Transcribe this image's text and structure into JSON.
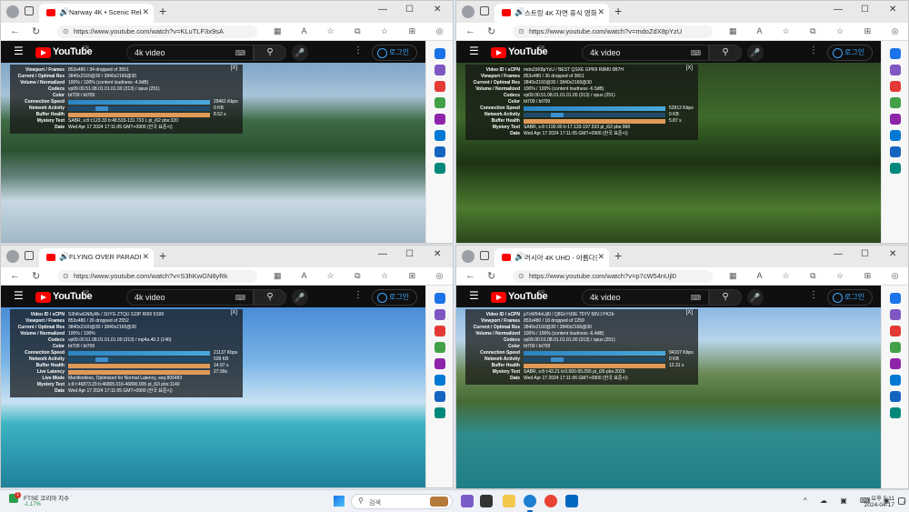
{
  "windows": [
    {
      "tab_title": "Narway 4K • Scenic Relaxat",
      "url": "https://www.youtube.com/watch?v=KLuTLF3x9sA",
      "stats": [
        {
          "label": "Viewport / Frames",
          "value": "853x480 / 34 dropped of 3551"
        },
        {
          "label": "Current / Optimal Res",
          "value": "3840x2160@30 / 3840x2160@30"
        },
        {
          "label": "Volume / Normalized",
          "value": "100% / 100% (content loudness -4.9dB)"
        },
        {
          "label": "Codecs",
          "value": "vp09.00.51.08.01.01.01.00 (313) / opus (251)"
        },
        {
          "label": "Color",
          "value": "bt709 / bt709"
        },
        {
          "label": "Connection Speed",
          "bar": "speed",
          "value": "29461 Kbps"
        },
        {
          "label": "Network Activity",
          "bar": "net",
          "value": "0 KB"
        },
        {
          "label": "Buffer Health",
          "bar": "buf",
          "value": "8.52 s"
        },
        {
          "label": "Mystery Text",
          "value": "SABR, s:8 t:123.33 b:48.533-131.733 L pl_i62 pbs:320"
        },
        {
          "label": "Date",
          "value": "Wed Apr 17 2024 17:11:05 GMT+0900 (한국 표준시)"
        }
      ]
    },
    {
      "tab_title": "스트링 4K 자연 휴식 영화드",
      "url": "https://www.youtube.com/watch?v=mdoZdX8pYzU",
      "stats": [
        {
          "label": "Video ID / sCPN",
          "value": "mdoZdX8pYzU / BEST QSXE GPR9 R8M0 0B7H"
        },
        {
          "label": "Viewport / Frames",
          "value": "853x480 / 36 dropped of 3651"
        },
        {
          "label": "Current / Optimal Res",
          "value": "3840x2160@30 / 3840x2160@30"
        },
        {
          "label": "Volume / Normalized",
          "value": "100% / 100% (content loudness -6.5dB)"
        },
        {
          "label": "Codecs",
          "value": "vp09.00.51.08.01.01.01.00 (313) / opus (251)"
        },
        {
          "label": "Color",
          "value": "bt709 / bt709"
        },
        {
          "label": "Connection Speed",
          "bar": "speed",
          "value": "53912 Kbps"
        },
        {
          "label": "Network Activity",
          "bar": "net",
          "value": "0 KB"
        },
        {
          "label": "Buffer Health",
          "bar": "buf",
          "value": "5.87 s"
        },
        {
          "label": "Mystery Text",
          "value": "SABR, s:8 t:190.90 b:17.133-197.533 pl_i62 pbs:968"
        },
        {
          "label": "Date",
          "value": "Wed Apr 17 2024 17:11:05 GMT+0900 (한국 표준시)"
        }
      ]
    },
    {
      "tab_title": "FLYING OVER PARADISE (4K",
      "url": "https://www.youtube.com/watch?v=S3hKwGN8yRk",
      "stats": [
        {
          "label": "Video ID / sCPN",
          "value": "S3hKwGN8yRk / 3UYG ZTQU 3J3P R0I9 5S90"
        },
        {
          "label": "Viewport / Frames",
          "value": "853x480 / 26 dropped of 2552"
        },
        {
          "label": "Current / Optimal Res",
          "value": "3840x2160@30 / 3840x2160@30"
        },
        {
          "label": "Volume / Normalized",
          "value": "100% / 100%"
        },
        {
          "label": "Codecs",
          "value": "vp09.00.51.08.01.01.01.00 (313) / mp4a.40.2 (140)"
        },
        {
          "label": "Color",
          "value": "bt709 / bt709"
        },
        {
          "label": "Connection Speed",
          "bar": "speed",
          "value": "21137 Kbps"
        },
        {
          "label": "Network Activity",
          "bar": "net",
          "value": "528 KB"
        },
        {
          "label": "Buffer Health",
          "bar": "buf",
          "value": "14.97 s"
        },
        {
          "label": "Live Latency",
          "bar": "buf",
          "value": "27.99s"
        },
        {
          "label": "Live Mode",
          "value": "Manifestless, Optimized for Normal Latency, seq 805483"
        },
        {
          "label": "Mystery Text",
          "value": "s:8 t:46873.29 b:46805.016-46890.005 pl_i63 pbs:1140"
        },
        {
          "label": "Date",
          "value": "Wed Apr 17 2024 17:11:05 GMT+0900 (한국 표준시)"
        }
      ]
    },
    {
      "tab_title": "러시아 4K UHD - 아름다운",
      "url": "https://www.youtube.com/watch?v=p7cW54nUjl0",
      "stats": [
        {
          "label": "Video ID / sCPN",
          "value": "p7cW54nUjl0 / Q8Gt HJ6E 75YV 58VJ PK2b"
        },
        {
          "label": "Viewport / Frames",
          "value": "853x480 / 18 dropped of 1259"
        },
        {
          "label": "Current / Optimal Res",
          "value": "3840x2160@30 / 3840x2160@30"
        },
        {
          "label": "Volume / Normalized",
          "value": "100% / 100% (content loudness -6.4dB)"
        },
        {
          "label": "Codecs",
          "value": "vp09.00.51.08.01.01.01.00 (313) / opus (251)"
        },
        {
          "label": "Color",
          "value": "bt709 / bt709"
        },
        {
          "label": "Connection Speed",
          "bar": "speed",
          "value": "94107 Kbps"
        },
        {
          "label": "Network Activity",
          "bar": "net",
          "value": "0 KB"
        },
        {
          "label": "Buffer Health",
          "bar": "buf",
          "value": "12.31 s"
        },
        {
          "label": "Mystery Text",
          "value": "SABR, s:8 t:43.21 b:0.000-55.055 pl_i26 pbs:2029"
        },
        {
          "label": "Date",
          "value": "Wed Apr 17 2024 17:11:06 GMT+0900 (한국 표준시)"
        }
      ]
    }
  ],
  "youtube": {
    "logo": "YouTube",
    "region": "KR",
    "search_value": "4k video",
    "login_label": "로그인",
    "stats_close": "[X]"
  },
  "taskbar": {
    "widget_title": "FTSE 코리아 지수",
    "widget_sub": "-1.17%",
    "widget_badge": "1",
    "search_placeholder": "검색",
    "clock_time": "오후 5:11",
    "clock_date": "2024-04-17"
  },
  "icons": {
    "search": "search-icon",
    "mic": "mic-icon",
    "more": "more-icon",
    "hamburger": "menu-icon"
  }
}
